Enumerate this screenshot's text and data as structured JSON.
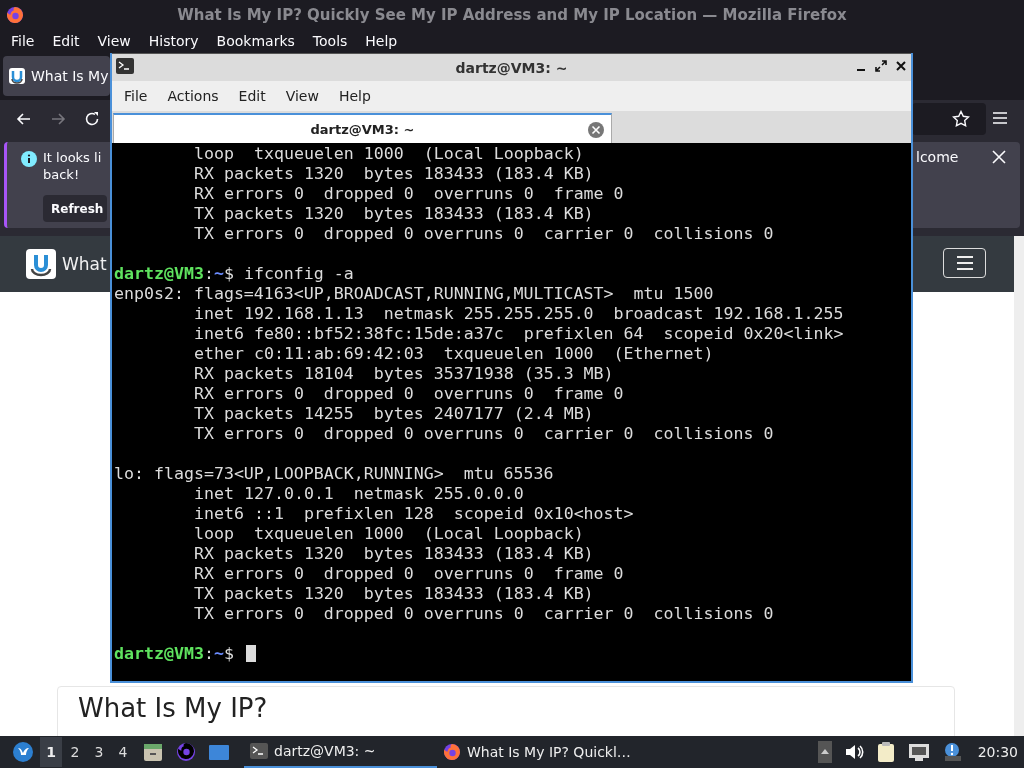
{
  "firefox": {
    "title": "What Is My IP? Quickly See My IP Address and My IP Location — Mozilla Firefox",
    "menu": [
      "File",
      "Edit",
      "View",
      "History",
      "Bookmarks",
      "Tools",
      "Help"
    ],
    "tab": {
      "label": "What Is My",
      "selected": true
    },
    "notification": {
      "message_lines": [
        "It looks li",
        "back!"
      ],
      "message_tail": "lcome",
      "button": "Refresh"
    },
    "site": {
      "brand": "What",
      "heading": "What Is My IP?"
    }
  },
  "terminal": {
    "title": "dartz@VM3: ~",
    "menu": [
      "File",
      "Actions",
      "Edit",
      "View",
      "Help"
    ],
    "tab": {
      "label": "dartz@VM3: ~",
      "selected": true
    },
    "lines": [
      {
        "kind": "detail",
        "text": "loop  txqueuelen 1000  (Local Loopback)"
      },
      {
        "kind": "detail",
        "text": "RX packets 1320  bytes 183433 (183.4 KB)"
      },
      {
        "kind": "detail",
        "text": "RX errors 0  dropped 0  overruns 0  frame 0"
      },
      {
        "kind": "detail",
        "text": "TX packets 1320  bytes 183433 (183.4 KB)"
      },
      {
        "kind": "detail",
        "text": "TX errors 0  dropped 0 overruns 0  carrier 0  collisions 0"
      },
      {
        "kind": "blank"
      },
      {
        "kind": "prompt",
        "user": "dartz@VM3",
        "separator": ":",
        "path": "~",
        "symbol": "$",
        "command": "ifconfig -a",
        "cursor": false
      },
      {
        "kind": "header",
        "text": "enp0s2: flags=4163<UP,BROADCAST,RUNNING,MULTICAST>  mtu 1500"
      },
      {
        "kind": "detail",
        "text": "inet 192.168.1.13  netmask 255.255.255.0  broadcast 192.168.1.255"
      },
      {
        "kind": "detail",
        "text": "inet6 fe80::bf52:38fc:15de:a37c  prefixlen 64  scopeid 0x20<link>"
      },
      {
        "kind": "detail",
        "text": "ether c0:11:ab:69:42:03  txqueuelen 1000  (Ethernet)"
      },
      {
        "kind": "detail",
        "text": "RX packets 18104  bytes 35371938 (35.3 MB)"
      },
      {
        "kind": "detail",
        "text": "RX errors 0  dropped 0  overruns 0  frame 0"
      },
      {
        "kind": "detail",
        "text": "TX packets 14255  bytes 2407177 (2.4 MB)"
      },
      {
        "kind": "detail",
        "text": "TX errors 0  dropped 0 overruns 0  carrier 0  collisions 0"
      },
      {
        "kind": "blank"
      },
      {
        "kind": "header",
        "text": "lo: flags=73<UP,LOOPBACK,RUNNING>  mtu 65536"
      },
      {
        "kind": "detail",
        "text": "inet 127.0.0.1  netmask 255.0.0.0"
      },
      {
        "kind": "detail",
        "text": "inet6 ::1  prefixlen 128  scopeid 0x10<host>"
      },
      {
        "kind": "detail",
        "text": "loop  txqueuelen 1000  (Local Loopback)"
      },
      {
        "kind": "detail",
        "text": "RX packets 1320  bytes 183433 (183.4 KB)"
      },
      {
        "kind": "detail",
        "text": "RX errors 0  dropped 0  overruns 0  frame 0"
      },
      {
        "kind": "detail",
        "text": "TX packets 1320  bytes 183433 (183.4 KB)"
      },
      {
        "kind": "detail",
        "text": "TX errors 0  dropped 0 overruns 0  carrier 0  collisions 0"
      },
      {
        "kind": "blank"
      },
      {
        "kind": "prompt",
        "user": "dartz@VM3",
        "separator": ":",
        "path": "~",
        "symbol": "$",
        "cursor": true
      }
    ]
  },
  "taskbar": {
    "workspaces": [
      {
        "label": "1",
        "selected": true
      },
      {
        "label": "2",
        "selected": false
      },
      {
        "label": "3",
        "selected": false
      },
      {
        "label": "4",
        "selected": false
      }
    ],
    "tasks": [
      {
        "kind": "terminal",
        "label": "dartz@VM3: ~",
        "selected": true
      },
      {
        "kind": "browser",
        "label": "What Is My IP? Quickl…",
        "selected": false
      }
    ],
    "clock": "20:30"
  }
}
